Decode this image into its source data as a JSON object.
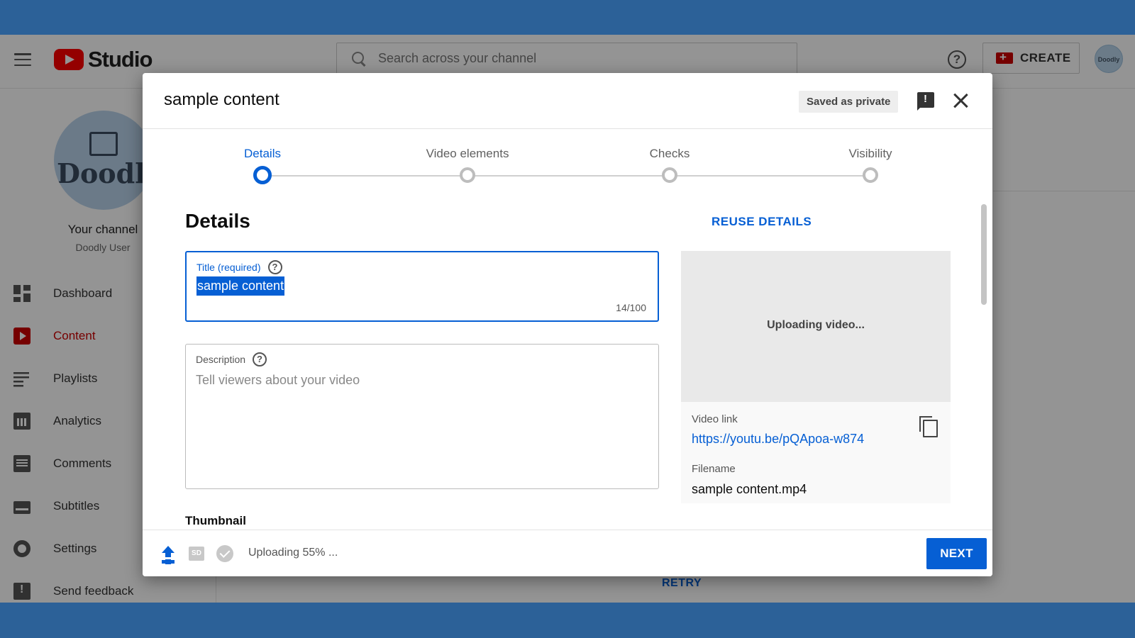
{
  "app": {
    "logo_text": "Studio",
    "search_placeholder": "Search across your channel",
    "create_label": "CREATE",
    "help_glyph": "?",
    "avatar_text": "Doodly"
  },
  "sidebar": {
    "channel_avatar_text": "Doodly",
    "channel_label": "Your channel",
    "channel_user": "Doodly User",
    "items": [
      {
        "label": "Dashboard",
        "icon": "dashboard-icon",
        "active": false
      },
      {
        "label": "Content",
        "icon": "content-icon",
        "active": true
      },
      {
        "label": "Playlists",
        "icon": "playlists-icon",
        "active": false
      },
      {
        "label": "Analytics",
        "icon": "analytics-icon",
        "active": false
      },
      {
        "label": "Comments",
        "icon": "comments-icon",
        "active": false
      },
      {
        "label": "Subtitles",
        "icon": "subtitles-icon",
        "active": false
      },
      {
        "label": "Settings",
        "icon": "settings-icon",
        "active": false
      },
      {
        "label": "Send feedback",
        "icon": "feedback-icon",
        "active": false
      }
    ]
  },
  "background": {
    "retry_label": "RETRY"
  },
  "dialog": {
    "title": "sample content",
    "saved_status": "Saved as private",
    "steps": [
      {
        "label": "Details",
        "active": true
      },
      {
        "label": "Video elements",
        "active": false
      },
      {
        "label": "Checks",
        "active": false
      },
      {
        "label": "Visibility",
        "active": false
      }
    ],
    "section_title": "Details",
    "reuse_label": "REUSE DETAILS",
    "title_field": {
      "label": "Title (required)",
      "value": "sample content",
      "counter": "14/100"
    },
    "description_field": {
      "label": "Description",
      "placeholder": "Tell viewers about your video"
    },
    "thumbnail_label": "Thumbnail",
    "preview": {
      "status": "Uploading video...",
      "video_link_label": "Video link",
      "video_link": "https://youtu.be/pQApoa-w874",
      "filename_label": "Filename",
      "filename": "sample content.mp4"
    },
    "footer": {
      "upload_status": "Uploading 55% ...",
      "upload_progress_percent": 55,
      "sd_badge": "SD",
      "next_label": "NEXT"
    }
  },
  "colors": {
    "accent": "#065fd4",
    "brand_red": "#ff0000",
    "frame_band": "#2c6198"
  }
}
